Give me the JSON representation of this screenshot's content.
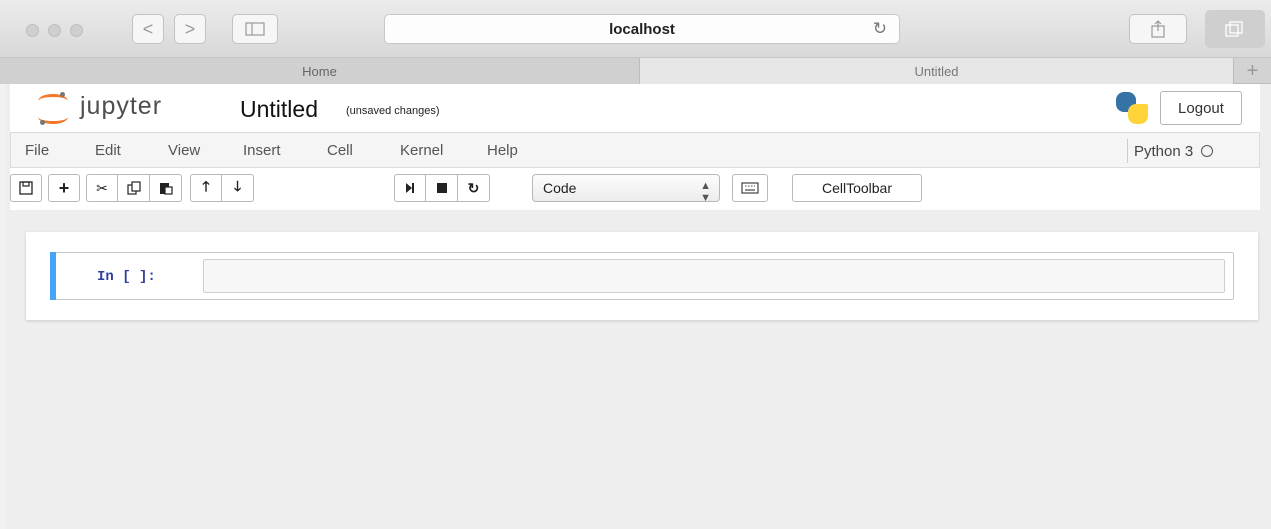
{
  "browser": {
    "url": "localhost",
    "tabs": [
      {
        "label": "Home"
      },
      {
        "label": "Untitled"
      }
    ],
    "new_tab_symbol": "+",
    "back_symbol": "<",
    "forward_symbol": ">"
  },
  "header": {
    "brand": "jupyter",
    "notebook_title": "Untitled",
    "save_status": "(unsaved changes)",
    "logout_label": "Logout"
  },
  "menubar": {
    "items": [
      "File",
      "Edit",
      "View",
      "Insert",
      "Cell",
      "Kernel",
      "Help"
    ],
    "kernel_name": "Python 3"
  },
  "toolbar": {
    "cell_type": "Code",
    "celltoolbar_label": "CellToolbar"
  },
  "cell": {
    "prompt": "In [ ]:",
    "source": ""
  },
  "colors": {
    "accent": "#42a5f5",
    "jupyter_orange": "#f37726",
    "prompt_blue": "#303f9f"
  }
}
